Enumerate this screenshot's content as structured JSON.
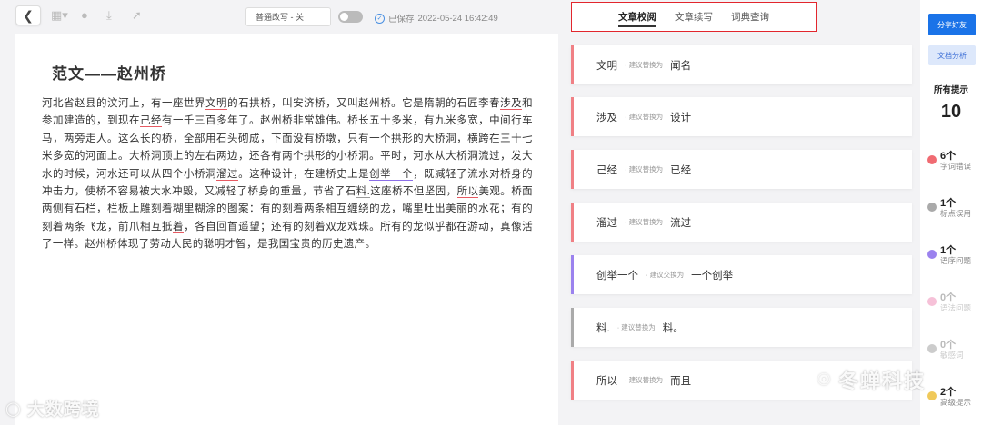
{
  "toolbar": {
    "back_icon": "chevron-left-icon",
    "mode_label": "普通改写 - 关",
    "saved_label": "已保存",
    "saved_time": "2022-05-24 16:42:49"
  },
  "document": {
    "title": "范文——赵州桥",
    "body": [
      {
        "t": "河北省赵县的汶河上，有一座世界"
      },
      {
        "t": "文明",
        "e": "red"
      },
      {
        "t": "的石拱桥，叫安济桥，又叫赵州桥。它是隋朝的石匠李春"
      },
      {
        "t": "涉及",
        "e": "red"
      },
      {
        "t": "和参加建造的，到现在"
      },
      {
        "t": "己经",
        "e": "red"
      },
      {
        "t": "有一千三百多年了。赵州桥非常雄伟。桥长五十多米，有九米多宽，中间行车马，两旁走人。这么长的桥，全部用石头砌成，下面没有桥墩，只有一个拱形的大桥洞，横跨在三十七米多宽的河面上。大桥洞顶上的左右两边，还各有两个拱形的小桥洞。平时，河水从大桥洞流过，发大水的时候，河水还可以从四个小桥洞"
      },
      {
        "t": "溜过",
        "e": "red"
      },
      {
        "t": "。这种设计，在建桥史上是"
      },
      {
        "t": "创举一个",
        "e": "purple"
      },
      {
        "t": "，既减轻了流水对桥身的冲击力，使桥不容易被大水冲毁，又减轻了桥身的重量，节省了石"
      },
      {
        "t": "料.",
        "e": "gray"
      },
      {
        "t": "这座桥不但坚固，"
      },
      {
        "t": "所以",
        "e": "red"
      },
      {
        "t": "美观。桥面两侧有石栏，栏板上雕刻着糊里糊涂的图案：有的刻着两条相互缠绕的龙，嘴里吐出美丽的水花；有的刻着两条飞龙，前爪相互抵"
      },
      {
        "t": "着",
        "e": "red"
      },
      {
        "t": "，各自回首遥望；还有的刻着双龙戏珠。所有的龙似乎都在游动，真像活了一样。赵州桥体现了劳动人民的聪明才智，是我国宝贵的历史遗产。"
      }
    ]
  },
  "tabs": [
    {
      "label": "文章校阅",
      "active": true
    },
    {
      "label": "文章续写",
      "active": false
    },
    {
      "label": "词典查询",
      "active": false
    }
  ],
  "suggestions": [
    {
      "orig": "文明",
      "hint": "· 建议替换为",
      "new": "闻名",
      "color": "#f08085"
    },
    {
      "orig": "涉及",
      "hint": "· 建议替换为",
      "new": "设计",
      "color": "#f08085"
    },
    {
      "orig": "己经",
      "hint": "· 建议替换为",
      "new": "已经",
      "color": "#f08085"
    },
    {
      "orig": "溜过",
      "hint": "· 建议替换为",
      "new": "流过",
      "color": "#f08085"
    },
    {
      "orig": "创举一个",
      "hint": "· 建议交换为",
      "new": "一个创举",
      "color": "#9b82ee"
    },
    {
      "orig": "料.",
      "hint": "· 建议替换为",
      "new": "料。",
      "color": "#aaaaaa"
    },
    {
      "orig": "所以",
      "hint": "· 建议替换为",
      "new": "而且",
      "color": "#f08085"
    }
  ],
  "sidebar": {
    "share_label": "分享好友",
    "analysis_label": "文档分析",
    "all_label": "所有提示",
    "all_count": "10",
    "stats": [
      {
        "count": "6个",
        "label": "字词错误",
        "color": "#f06b72",
        "faded": false
      },
      {
        "count": "1个",
        "label": "标点误用",
        "color": "#aaaaaa",
        "faded": false
      },
      {
        "count": "1个",
        "label": "语序问题",
        "color": "#9b82ee",
        "faded": false
      },
      {
        "count": "0个",
        "label": "语法问题",
        "color": "#f6c1d8",
        "faded": true
      },
      {
        "count": "0个",
        "label": "敏感词",
        "color": "#cccccc",
        "faded": true
      },
      {
        "count": "2个",
        "label": "高级提示",
        "color": "#f0c95a",
        "faded": false
      }
    ]
  },
  "watermarks": {
    "left_text": "大数跨境",
    "right_text": "冬蝉科技"
  }
}
